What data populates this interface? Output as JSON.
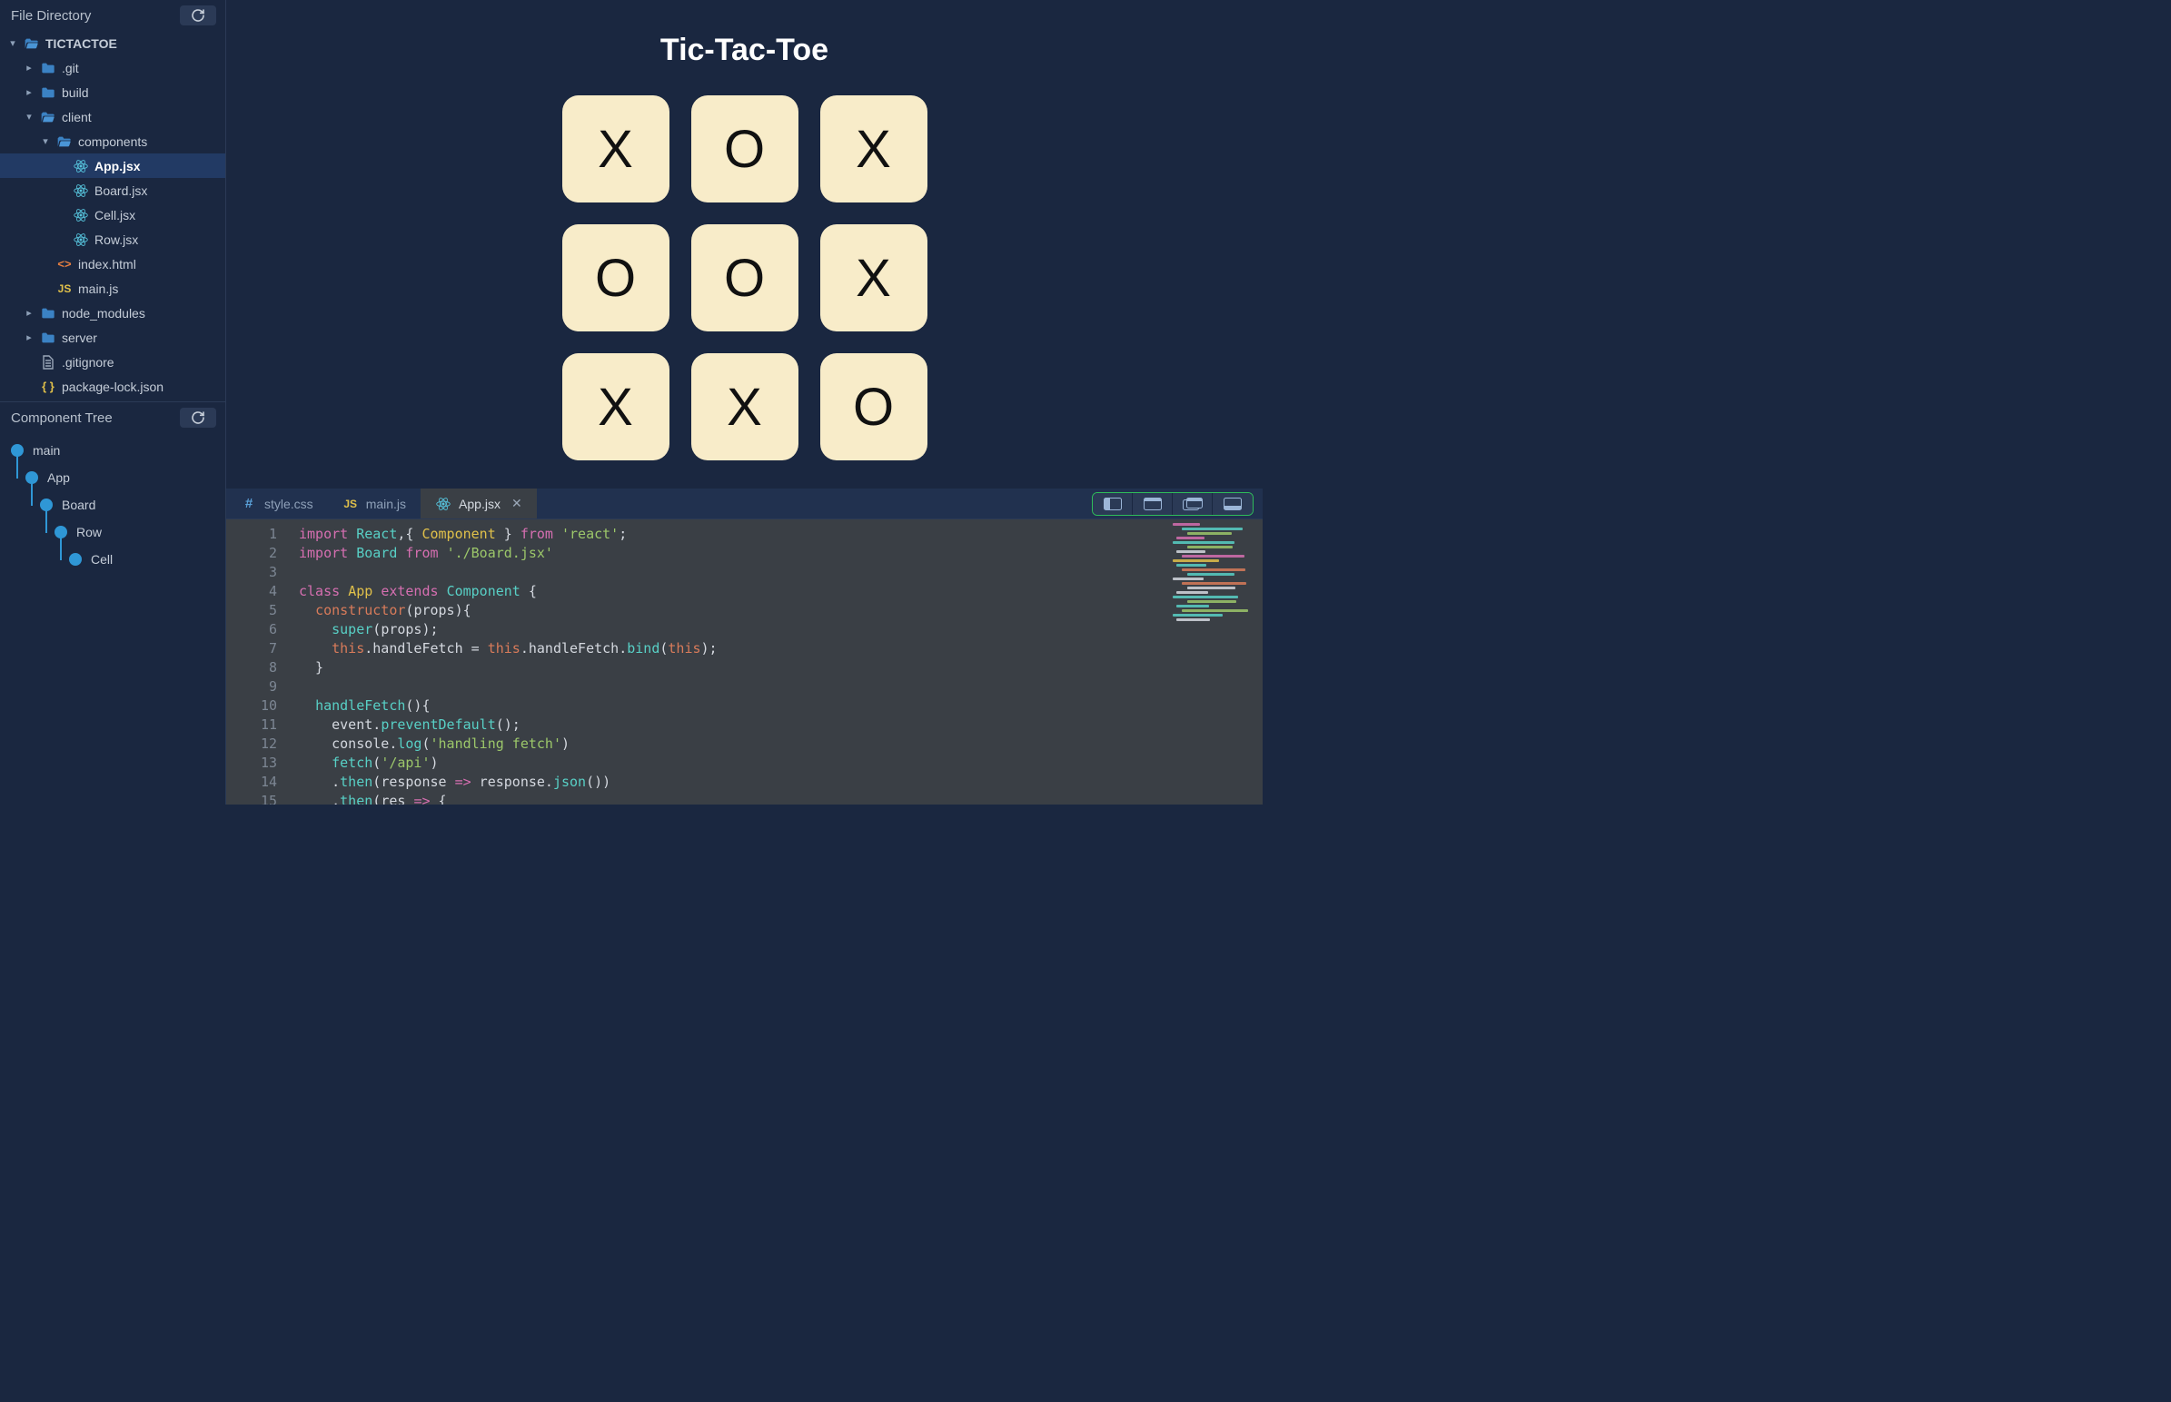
{
  "sidebar": {
    "file_directory_title": "File Directory",
    "component_tree_title": "Component Tree",
    "tree": [
      {
        "depth": 0,
        "caret": "down",
        "icon": "folder-open",
        "label": "TICTACTOE",
        "bold": true
      },
      {
        "depth": 1,
        "caret": "right",
        "icon": "folder",
        "label": ".git"
      },
      {
        "depth": 1,
        "caret": "right",
        "icon": "folder",
        "label": "build"
      },
      {
        "depth": 1,
        "caret": "down",
        "icon": "folder-open",
        "label": "client"
      },
      {
        "depth": 2,
        "caret": "down",
        "icon": "folder-open",
        "label": "components"
      },
      {
        "depth": 3,
        "caret": "",
        "icon": "react",
        "label": "App.jsx",
        "selected": true,
        "bold": true
      },
      {
        "depth": 3,
        "caret": "",
        "icon": "react",
        "label": "Board.jsx"
      },
      {
        "depth": 3,
        "caret": "",
        "icon": "react",
        "label": "Cell.jsx"
      },
      {
        "depth": 3,
        "caret": "",
        "icon": "react",
        "label": "Row.jsx"
      },
      {
        "depth": 2,
        "caret": "",
        "icon": "html",
        "label": "index.html"
      },
      {
        "depth": 2,
        "caret": "",
        "icon": "js",
        "label": "main.js"
      },
      {
        "depth": 1,
        "caret": "right",
        "icon": "folder",
        "label": "node_modules"
      },
      {
        "depth": 1,
        "caret": "right",
        "icon": "folder",
        "label": "server"
      },
      {
        "depth": 1,
        "caret": "",
        "icon": "file",
        "label": ".gitignore"
      },
      {
        "depth": 1,
        "caret": "",
        "icon": "json",
        "label": "package-lock.json"
      }
    ],
    "components": [
      {
        "depth": 0,
        "label": "main"
      },
      {
        "depth": 1,
        "label": "App"
      },
      {
        "depth": 2,
        "label": "Board"
      },
      {
        "depth": 3,
        "label": "Row"
      },
      {
        "depth": 4,
        "label": "Cell"
      }
    ]
  },
  "preview": {
    "title": "Tic-Tac-Toe",
    "cells": [
      "X",
      "O",
      "X",
      "O",
      "O",
      "X",
      "X",
      "X",
      "O"
    ]
  },
  "editor": {
    "tabs": [
      {
        "icon": "hash",
        "label": "style.css",
        "active": false
      },
      {
        "icon": "js",
        "label": "main.js",
        "active": false
      },
      {
        "icon": "react",
        "label": "App.jsx",
        "active": true,
        "closeable": true
      }
    ],
    "line_numbers": [
      "1",
      "2",
      "3",
      "4",
      "5",
      "6",
      "7",
      "8",
      "9",
      "10",
      "11",
      "12",
      "13",
      "14",
      "15"
    ],
    "code_lines": [
      [
        {
          "t": "import ",
          "c": "kw"
        },
        {
          "t": "React",
          "c": "fn"
        },
        {
          "t": ",{ ",
          "c": "pn"
        },
        {
          "t": "Component",
          "c": "cls"
        },
        {
          "t": " } ",
          "c": "pn"
        },
        {
          "t": "from ",
          "c": "kw"
        },
        {
          "t": "'react'",
          "c": "str"
        },
        {
          "t": ";",
          "c": "pn"
        }
      ],
      [
        {
          "t": "import ",
          "c": "kw"
        },
        {
          "t": "Board",
          "c": "fn"
        },
        {
          "t": " ",
          "c": "pn"
        },
        {
          "t": "from ",
          "c": "kw"
        },
        {
          "t": "'./Board.jsx'",
          "c": "str"
        }
      ],
      [
        {
          "t": "",
          "c": "pn"
        }
      ],
      [
        {
          "t": "class ",
          "c": "kw"
        },
        {
          "t": "App ",
          "c": "cls"
        },
        {
          "t": "extends ",
          "c": "kw"
        },
        {
          "t": "Component",
          "c": "fn"
        },
        {
          "t": " {",
          "c": "pn"
        }
      ],
      [
        {
          "t": "  ",
          "c": "pn"
        },
        {
          "t": "constructor",
          "c": "this"
        },
        {
          "t": "(",
          "c": "pn"
        },
        {
          "t": "props",
          "c": "prop"
        },
        {
          "t": "){",
          "c": "pn"
        }
      ],
      [
        {
          "t": "    ",
          "c": "pn"
        },
        {
          "t": "super",
          "c": "fn"
        },
        {
          "t": "(",
          "c": "pn"
        },
        {
          "t": "props",
          "c": "prop"
        },
        {
          "t": ");",
          "c": "pn"
        }
      ],
      [
        {
          "t": "    ",
          "c": "pn"
        },
        {
          "t": "this",
          "c": "this"
        },
        {
          "t": ".handleFetch = ",
          "c": "pn"
        },
        {
          "t": "this",
          "c": "this"
        },
        {
          "t": ".handleFetch.",
          "c": "pn"
        },
        {
          "t": "bind",
          "c": "fn"
        },
        {
          "t": "(",
          "c": "pn"
        },
        {
          "t": "this",
          "c": "this"
        },
        {
          "t": ");",
          "c": "pn"
        }
      ],
      [
        {
          "t": "  }",
          "c": "pn"
        }
      ],
      [
        {
          "t": "",
          "c": "pn"
        }
      ],
      [
        {
          "t": "  ",
          "c": "pn"
        },
        {
          "t": "handleFetch",
          "c": "fn"
        },
        {
          "t": "(){",
          "c": "pn"
        }
      ],
      [
        {
          "t": "    event.",
          "c": "pn"
        },
        {
          "t": "preventDefault",
          "c": "fn"
        },
        {
          "t": "();",
          "c": "pn"
        }
      ],
      [
        {
          "t": "    console.",
          "c": "pn"
        },
        {
          "t": "log",
          "c": "fn"
        },
        {
          "t": "(",
          "c": "pn"
        },
        {
          "t": "'handling fetch'",
          "c": "str"
        },
        {
          "t": ")",
          "c": "pn"
        }
      ],
      [
        {
          "t": "    ",
          "c": "pn"
        },
        {
          "t": "fetch",
          "c": "fn"
        },
        {
          "t": "(",
          "c": "pn"
        },
        {
          "t": "'/api'",
          "c": "str"
        },
        {
          "t": ")",
          "c": "pn"
        }
      ],
      [
        {
          "t": "    .",
          "c": "pn"
        },
        {
          "t": "then",
          "c": "fn"
        },
        {
          "t": "(",
          "c": "pn"
        },
        {
          "t": "response",
          "c": "prop"
        },
        {
          "t": " ",
          "c": "pn"
        },
        {
          "t": "=>",
          "c": "kw"
        },
        {
          "t": " response.",
          "c": "pn"
        },
        {
          "t": "json",
          "c": "fn"
        },
        {
          "t": "())",
          "c": "pn"
        }
      ],
      [
        {
          "t": "    .",
          "c": "pn"
        },
        {
          "t": "then",
          "c": "fn"
        },
        {
          "t": "(",
          "c": "pn"
        },
        {
          "t": "res",
          "c": "prop"
        },
        {
          "t": " ",
          "c": "pn"
        },
        {
          "t": "=>",
          "c": "kw"
        },
        {
          "t": " {",
          "c": "pn"
        }
      ]
    ]
  }
}
